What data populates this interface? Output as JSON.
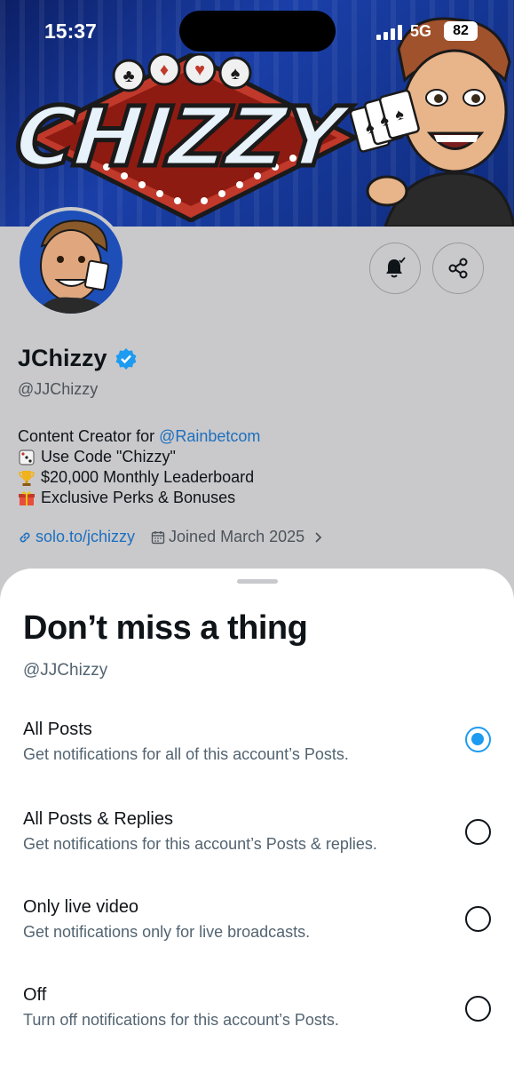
{
  "status_bar": {
    "time": "15:37",
    "network": "5G",
    "battery": "82"
  },
  "banner": {
    "logo_text": "CHIZZY"
  },
  "profile": {
    "name": "JChizzy",
    "handle": "@JJChizzy",
    "bio": {
      "line1_prefix": "Content Creator for ",
      "line1_link": "@Rainbetcom",
      "line2": "Use Code \"Chizzy\"",
      "line3": "$20,000 Monthly Leaderboard",
      "line4": "Exclusive Perks & Bonuses"
    },
    "website": "solo.to/jchizzy",
    "joined": "Joined March 2025"
  },
  "icons": {
    "notifications": "bell-check-icon",
    "share": "share-icon",
    "verified": "verified-badge-icon",
    "link": "link-icon",
    "calendar": "calendar-icon",
    "chevron": "chevron-right-icon"
  },
  "sheet": {
    "title": "Don’t miss a thing",
    "handle": "@JJChizzy",
    "options": [
      {
        "title": "All Posts",
        "description": "Get notifications for all of this account’s Posts.",
        "selected": true
      },
      {
        "title": "All Posts & Replies",
        "description": "Get notifications for this account’s Posts & replies.",
        "selected": false
      },
      {
        "title": "Only live video",
        "description": "Get notifications only for live broadcasts.",
        "selected": false
      },
      {
        "title": "Off",
        "description": "Turn off notifications for this account’s Posts.",
        "selected": false
      }
    ]
  },
  "colors": {
    "accent": "#1d9bf0",
    "link": "#1d6fbf",
    "secondary_text": "#536471"
  }
}
